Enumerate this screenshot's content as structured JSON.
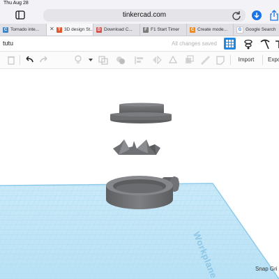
{
  "status_bar": {
    "time": "Thu Aug 28"
  },
  "browser": {
    "url": "tinkercad.com",
    "tabs": [
      {
        "label": "Tornado inte...",
        "favicon": "C",
        "color": "#3f86c9",
        "active": false
      },
      {
        "label": "3D design St...",
        "favicon": "T",
        "color": "#e4572e",
        "active": true
      },
      {
        "label": "Download C...",
        "favicon": "D",
        "color": "#d9534f",
        "active": false
      },
      {
        "label": "F1 Start Timer",
        "favicon": "F",
        "color": "#7b7b7b",
        "active": false
      },
      {
        "label": "Create mode...",
        "favicon": "C",
        "color": "#f08a24",
        "active": false
      },
      {
        "label": "Google Search",
        "favicon": "G",
        "color": "#4285f4",
        "active": false
      }
    ]
  },
  "app": {
    "project_name": "tutu",
    "save_status": "All changes saved",
    "accent": "#1f88e5"
  },
  "toolbar": {
    "import_label": "Import",
    "export_label": "Expo"
  },
  "canvas": {
    "workplane_label": "Workplane",
    "snap_grid_label": "Snap Gri",
    "workplane_color": "#9bd3ee",
    "object_color": "#6e7072"
  }
}
